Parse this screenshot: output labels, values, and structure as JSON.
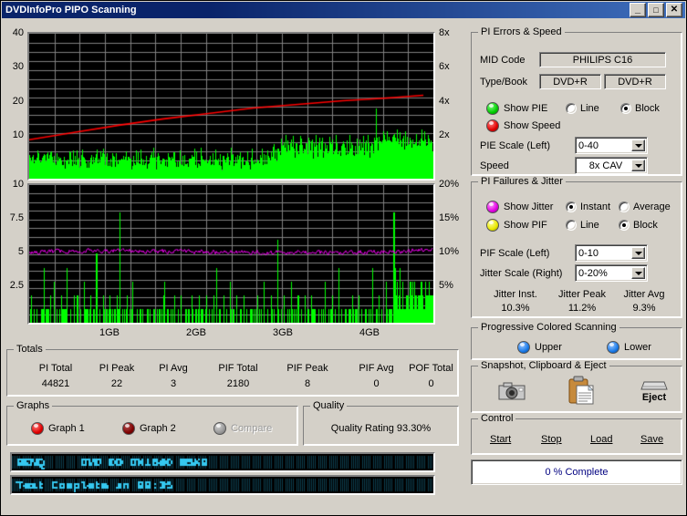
{
  "window": {
    "title": "DVDInfoPro PIPO Scanning",
    "buttons": {
      "minimize": "_",
      "maximize": "□",
      "close": "✕"
    }
  },
  "pi_errors_speed": {
    "legend": "PI Errors & Speed",
    "mid_code_label": "MID Code",
    "mid_code_value": "PHILIPS C16",
    "type_book_label": "Type/Book",
    "type_value": "DVD+R",
    "book_value": "DVD+R",
    "show_pie_label": "Show PIE",
    "show_speed_label": "Show Speed",
    "line_label": "Line",
    "block_label": "Block",
    "draw_mode": "Block",
    "pie_scale_label": "PIE Scale (Left)",
    "pie_scale_value": "0-40",
    "speed_label": "Speed",
    "speed_value": "8x CAV"
  },
  "pi_failures_jitter": {
    "legend": "PI Failures & Jitter",
    "show_jitter_label": "Show Jitter",
    "show_pif_label": "Show PIF",
    "instant_label": "Instant",
    "average_label": "Average",
    "jitter_mode": "Instant",
    "line_label": "Line",
    "block_label": "Block",
    "draw_mode": "Block",
    "pif_scale_label": "PIF Scale (Left)",
    "pif_scale_value": "0-10",
    "jitter_scale_label": "Jitter Scale (Right)",
    "jitter_scale_value": "0-20%",
    "jitter_inst_label": "Jitter Inst.",
    "jitter_inst_value": "10.3%",
    "jitter_peak_label": "Jitter Peak",
    "jitter_peak_value": "11.2%",
    "jitter_avg_label": "Jitter Avg",
    "jitter_avg_value": "9.3%"
  },
  "progressive_scanning": {
    "legend": "Progressive Colored Scanning",
    "upper_label": "Upper",
    "lower_label": "Lower"
  },
  "snapshot": {
    "legend": "Snapshot,  Clipboard  & Eject",
    "camera_icon": "camera-icon",
    "clipboard_icon": "clipboard-icon",
    "eject_icon": "eject-icon",
    "eject_label": "Eject"
  },
  "control": {
    "legend": "Control",
    "start_label": "Start",
    "stop_label": "Stop",
    "load_label": "Load",
    "save_label": "Save",
    "progress_text": "0 % Complete"
  },
  "totals": {
    "legend": "Totals",
    "columns": [
      {
        "label": "PI Total",
        "value": "44821"
      },
      {
        "label": "PI Peak",
        "value": "22"
      },
      {
        "label": "PI Avg",
        "value": "3"
      },
      {
        "label": "PIF Total",
        "value": "2180"
      },
      {
        "label": "PIF Peak",
        "value": "8"
      },
      {
        "label": "PIF Avg",
        "value": "0"
      },
      {
        "label": "POF Total",
        "value": "0"
      }
    ]
  },
  "graphs": {
    "legend": "Graphs",
    "graph1_label": "Graph 1",
    "graph2_label": "Graph 2",
    "compare_label": "Compare"
  },
  "quality": {
    "legend": "Quality",
    "rating_text": "Quality Rating 93.30%"
  },
  "lcd": {
    "line1": "BENQ     DVD DD DW1640 BSKB",
    "line2": "Test Complete in 09:35"
  },
  "colors": {
    "pie_green": "#00ff00",
    "speed_red": "#ff0000",
    "jitter_magenta": "#ee00ee",
    "pif_green": "#00ff00",
    "grid": "#808080",
    "plot_bg": "#000000",
    "lcd_text": "#35c8f0",
    "window_bg": "#d4d0c8",
    "title_bg": "#0a246a"
  },
  "chart_data": [
    {
      "type": "bar",
      "title": "PI Errors & Speed",
      "xlabel": "",
      "ylabel": "PI Errors",
      "y2label": "Speed",
      "xlim": [
        0,
        4.7
      ],
      "ylim": [
        0,
        40
      ],
      "y2lim": [
        0,
        8
      ],
      "grid": true,
      "yticks": [
        10,
        20,
        30,
        40
      ],
      "ytick_labels": [
        "10",
        "20",
        "30",
        "40"
      ],
      "y2ticks": [
        2,
        4,
        6,
        8
      ],
      "y2tick_labels": [
        "2x",
        "4x",
        "6x",
        "8x"
      ],
      "xticks": [
        1,
        2,
        3,
        4
      ],
      "xtick_labels": [
        "1GB",
        "2GB",
        "3GB",
        "4GB"
      ],
      "series": [
        {
          "name": "PIE",
          "color": "#00ff00",
          "style": "block",
          "comment": "Dense per-block PI error bars; baseline ~4-5, rising to ~8-10 after 3.5GB, one spike to 22 near 4.2GB",
          "values": [
            5,
            6,
            4,
            7,
            5,
            4,
            6,
            5,
            7,
            4,
            5,
            6,
            4,
            5,
            7,
            5,
            4,
            6,
            5,
            4,
            7,
            6,
            5,
            4,
            6,
            5,
            7,
            4,
            5,
            6,
            4,
            7,
            5,
            6,
            4,
            5,
            7,
            5,
            4,
            6,
            5,
            7,
            4,
            6,
            5,
            4,
            7,
            5,
            6,
            4,
            5,
            7,
            6,
            4,
            5,
            6,
            4,
            7,
            5,
            4,
            6,
            5,
            7,
            4,
            5,
            6,
            7,
            4,
            5,
            6,
            4,
            5,
            7,
            6,
            4,
            5,
            6,
            5,
            4,
            7,
            5,
            6,
            4,
            7,
            5,
            6,
            4,
            5,
            7,
            4,
            6,
            5,
            4,
            7,
            6,
            5,
            4,
            6,
            5,
            7,
            4,
            5,
            6,
            4,
            7,
            5,
            6,
            4,
            5,
            7,
            6,
            4,
            5,
            6,
            7,
            4,
            5,
            6,
            4,
            5,
            6,
            9,
            7,
            5,
            4,
            6,
            5,
            8,
            4,
            6,
            5,
            7,
            4,
            5,
            6,
            4,
            7,
            5,
            6,
            4,
            5,
            7,
            6,
            4,
            5,
            6,
            4,
            7,
            5,
            4,
            6,
            5,
            7,
            4,
            6,
            5,
            4,
            7,
            5,
            6,
            4,
            5,
            7,
            6,
            4,
            5,
            6,
            4,
            7,
            5,
            6,
            4,
            5,
            7,
            4,
            6,
            5,
            7,
            4,
            5,
            6,
            4,
            7,
            5,
            6,
            4,
            5,
            7,
            6,
            4,
            5,
            6,
            4,
            7,
            5,
            6,
            4,
            5,
            7,
            6,
            4,
            5,
            6,
            4,
            7,
            5,
            6,
            4,
            5,
            7,
            6,
            4,
            5,
            6,
            8,
            5,
            4,
            6,
            7,
            5,
            4,
            6,
            5,
            7,
            4,
            6,
            5,
            4,
            7,
            5,
            6,
            4,
            5,
            7,
            6,
            4,
            5,
            6,
            4,
            7,
            9,
            7,
            5,
            8,
            6,
            9,
            7,
            10,
            8,
            9,
            7,
            11,
            8,
            9,
            7,
            10,
            8,
            9,
            11,
            8,
            7,
            9,
            10,
            8,
            7,
            9,
            11,
            8,
            9,
            7,
            10,
            8,
            9,
            7,
            11,
            9,
            8,
            10,
            7,
            9,
            8,
            11,
            9,
            7,
            10,
            8,
            9,
            11,
            7,
            9,
            8,
            10,
            9,
            7,
            11,
            8,
            9,
            10,
            7,
            9,
            8,
            11,
            9,
            7,
            10,
            8,
            9,
            7,
            11,
            9,
            8,
            10,
            9,
            7,
            11,
            8,
            9,
            10,
            8,
            9,
            7,
            11,
            9,
            8,
            10,
            9,
            7,
            11,
            8,
            9,
            10,
            8,
            11,
            9,
            7,
            10,
            9,
            8,
            11,
            9,
            22,
            13,
            9,
            11,
            10,
            12,
            9,
            11,
            13,
            10,
            9,
            12,
            11,
            10,
            13,
            9,
            11,
            10,
            12,
            9,
            11,
            13,
            10,
            12,
            9,
            11,
            10,
            13,
            9,
            12,
            11,
            10,
            9,
            13,
            11,
            10,
            12,
            9,
            11,
            13,
            10,
            9,
            12,
            11,
            10,
            13,
            9,
            11,
            12,
            10,
            9,
            13,
            11,
            10,
            12,
            9
          ]
        },
        {
          "name": "Speed",
          "color": "#ff0000",
          "style": "line",
          "unit": "x",
          "comment": "CAV speed curve rising from ~2.15x at start to ~4.6x at end of disc",
          "x": [
            0.0,
            0.5,
            1.0,
            1.5,
            2.0,
            2.5,
            3.0,
            3.5,
            4.0,
            4.4
          ],
          "values": [
            2.15,
            2.55,
            2.95,
            3.3,
            3.6,
            3.9,
            4.1,
            4.3,
            4.45,
            4.6
          ]
        }
      ]
    },
    {
      "type": "bar",
      "title": "PI Failures & Jitter",
      "xlabel": "",
      "ylabel": "PI Failures",
      "y2label": "Jitter",
      "xlim": [
        0,
        4.7
      ],
      "ylim": [
        0,
        10
      ],
      "y2lim": [
        0,
        20
      ],
      "grid": true,
      "yticks": [
        2.5,
        5,
        7.5,
        10
      ],
      "ytick_labels": [
        "2.5",
        "5",
        "7.5",
        "10"
      ],
      "y2ticks": [
        5,
        10,
        15,
        20
      ],
      "y2tick_labels": [
        "5%",
        "10%",
        "15%",
        "20%"
      ],
      "xticks": [
        1,
        2,
        3,
        4
      ],
      "xtick_labels": [
        "1GB",
        "2GB",
        "3GB",
        "4GB"
      ],
      "series": [
        {
          "name": "PIF",
          "color": "#00ff00",
          "style": "block",
          "comment": "Sparse PI failure spikes, mostly 1-2, scattered spikes to 3-5, two spikes to 7-8",
          "values": [
            0,
            3,
            0,
            0,
            1,
            0,
            0,
            2,
            0,
            0,
            0,
            1,
            0,
            0,
            4,
            0,
            0,
            1,
            0,
            0,
            2,
            0,
            0,
            0,
            3,
            0,
            0,
            1,
            0,
            0,
            0,
            2,
            0,
            0,
            1,
            0,
            0,
            5,
            0,
            0,
            1,
            0,
            0,
            0,
            2,
            0,
            0,
            3,
            0,
            0,
            1,
            0,
            0,
            0,
            4,
            0,
            0,
            1,
            0,
            0,
            2,
            0,
            0,
            0,
            1,
            0,
            5,
            0,
            0,
            1,
            0,
            0,
            0,
            2,
            0,
            0,
            1,
            0,
            0,
            3,
            0,
            0,
            1,
            0,
            0,
            0,
            2,
            0,
            0,
            8,
            0,
            0,
            1,
            0,
            0,
            0,
            2,
            0,
            0,
            1,
            0,
            0,
            3,
            0,
            0,
            0,
            1,
            0,
            0,
            2,
            0,
            0,
            1,
            0,
            0,
            0,
            2,
            0,
            0,
            1,
            0,
            0,
            0,
            1,
            0,
            0,
            2,
            0,
            0,
            1,
            0,
            0,
            0,
            3,
            0,
            0,
            1,
            0,
            0,
            0,
            1,
            0,
            0,
            2,
            0,
            0,
            0,
            1,
            0,
            0,
            2,
            0,
            0,
            0,
            1,
            0,
            0,
            1,
            0,
            0,
            0,
            2,
            0,
            0,
            1,
            0,
            0,
            0,
            3,
            0,
            0,
            1,
            0,
            0,
            0,
            2,
            0,
            0,
            1,
            0,
            0,
            0,
            2,
            0,
            0,
            4,
            0,
            0,
            1,
            0,
            0,
            0,
            2,
            0,
            0,
            1,
            0,
            0,
            0,
            3,
            0,
            0,
            1,
            0,
            0,
            2,
            0,
            0,
            0,
            1,
            0,
            0,
            3,
            0,
            0,
            1,
            0,
            0,
            0,
            2,
            0,
            0,
            1,
            0,
            0,
            0,
            2,
            0,
            0,
            1,
            0,
            0,
            3,
            0,
            0,
            0,
            1,
            0,
            0,
            2,
            0,
            0,
            1,
            0,
            0,
            0,
            7,
            0,
            0,
            1,
            0,
            0,
            2,
            0,
            0,
            0,
            1,
            0,
            0,
            3,
            0,
            0,
            1,
            0,
            0,
            0,
            2,
            0,
            0,
            1,
            0,
            0,
            0,
            3,
            0,
            0,
            1,
            0,
            0,
            2,
            0,
            0,
            0,
            1,
            0,
            0,
            2,
            0,
            0,
            1,
            0,
            0,
            0,
            3,
            0,
            0,
            1,
            0,
            0,
            0,
            2,
            0,
            0,
            1,
            0,
            0,
            4,
            0,
            0,
            1,
            0,
            0,
            0,
            2,
            0,
            0,
            1,
            0,
            0,
            0,
            2,
            0,
            0,
            1,
            0,
            0,
            3,
            0,
            0,
            1,
            0,
            0,
            0,
            2,
            0,
            0,
            1,
            0,
            0,
            0,
            5,
            0,
            0,
            1,
            0,
            0,
            2,
            0,
            0,
            1,
            0,
            0,
            0,
            3,
            0,
            0,
            1,
            0,
            0,
            2,
            0,
            8,
            5,
            2,
            3,
            1,
            2,
            4,
            2,
            1,
            3,
            2,
            1,
            2,
            3,
            1,
            2,
            1,
            3,
            2,
            1,
            2,
            1,
            3,
            2,
            1,
            2,
            3,
            1,
            2,
            1,
            2,
            3,
            1,
            2,
            1,
            3,
            2,
            1,
            2
          ]
        },
        {
          "name": "Jitter",
          "color": "#ee00ee",
          "style": "line",
          "unit": "%",
          "comment": "Instantaneous jitter noise band centered ~10.3%, peak 11.2%, average 9.3%",
          "mean": 10.3,
          "peak": 11.2,
          "avg": 9.3
        }
      ]
    }
  ]
}
